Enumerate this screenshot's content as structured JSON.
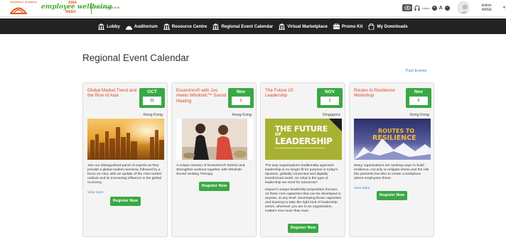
{
  "header": {
    "brand_top": "UNIVERSITY BUSINESS",
    "brand_asia": "ASIA",
    "brand_script": "employee wellbeing",
    "brand_week": "WEEK",
    "brand_dates": "8 - 10 OCTOBER 2019",
    "listen_label": "Listen",
    "user_name": "Admin AWEE"
  },
  "nav": {
    "items": [
      {
        "label": "Lobby",
        "icon": "building-icon"
      },
      {
        "label": "Auditorium",
        "icon": "auditorium-icon"
      },
      {
        "label": "Resource Centre",
        "icon": "building-icon"
      },
      {
        "label": "Regional Event Calendar",
        "icon": "building-icon"
      },
      {
        "label": "Virtual Marketplace",
        "icon": "building-icon"
      },
      {
        "label": "Promo Kit",
        "icon": "promo-kit-icon"
      },
      {
        "label": "My Downloads",
        "icon": "bag-icon"
      }
    ]
  },
  "page": {
    "title": "Regional Event Calendar",
    "past_events": "Past Events"
  },
  "events": [
    {
      "title": "Global Market Trend and the Rise of Asia",
      "month": "OCT",
      "day": "31",
      "location": "Hong Kong",
      "description": [
        "Join our distinguished panel of experts as they provide a global market overview, followed by a focus on Asia, with an update of the Asia market outlook and its increasing influence in the global economy."
      ],
      "view_more": "View more",
      "register": "Register Now"
    },
    {
      "title": "Essentrics® with Jos meets Wholistic™ Sound Healing",
      "month": "Nov",
      "day": "1",
      "location": "Hong Kong",
      "description": [
        "A unique session of Essentrics® Stretch and Strengthen workout together with Wholistic Sound Healing Therapy"
      ],
      "view_more": "",
      "register": "Register Now"
    },
    {
      "title": "The Future Of Leadership",
      "month": "NOV",
      "day": "1",
      "location": "Singapore",
      "image_text": [
        "THE FUTURE",
        "OF",
        "LEADERSHIP"
      ],
      "description": [
        "The way organisations traditionally approach leadership is no longer fit for purpose in today's dynamic, globally connected and digitally transformed world. So what is the type of leadership we need for tomorrow?",
        "Impact's unique leadership proposition focuses on three core capacities that can be developed in anyone, at any level. Developing those capacities and learning to take the right kind of leadership action, wherever you are in an organisation, matters now more than ever."
      ],
      "view_more": "",
      "register": "Register Now"
    },
    {
      "title": "Routes to Resilience Workshop",
      "month": "Nov",
      "day": "6",
      "location": "Hong Kong",
      "image_text": [
        "ROUTES TO",
        "RESILIENCE"
      ],
      "description": [
        "Many organisations are seeking ways to build resilience, not only to mitigate stress and the risk this presents but also to create a workplace where employees thrive."
      ],
      "view_more": "View More",
      "register": "Register Now"
    }
  ],
  "colors": {
    "nav_bg": "#222222",
    "accent_green": "#3aa844",
    "title_orange": "#e0461a",
    "link_blue": "#3a83c4"
  }
}
